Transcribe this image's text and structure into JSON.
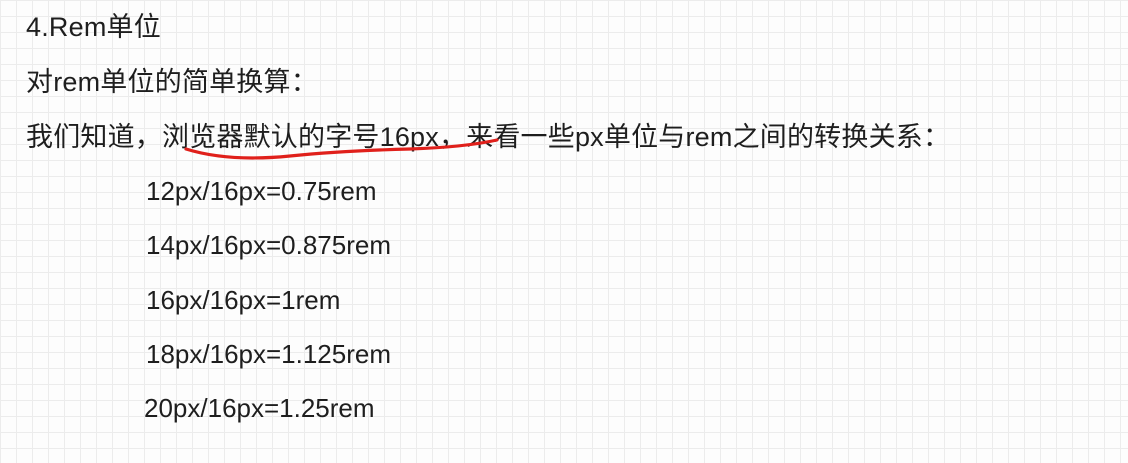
{
  "heading": "4.Rem单位",
  "intro": "对rem单位的简单换算：",
  "paragraph": {
    "before": "我们知道，",
    "highlighted": "浏览器默认的字号16px",
    "after": "，来看一些px单位与rem之间的转换关系："
  },
  "conversions": [
    "12px/16px=0.75rem",
    "14px/16px=0.875rem",
    "16px/16px=1rem",
    "18px/16px=1.125rem",
    "20px/16px=1.25rem"
  ],
  "annotation": {
    "stroke_color": "#e0201b"
  }
}
